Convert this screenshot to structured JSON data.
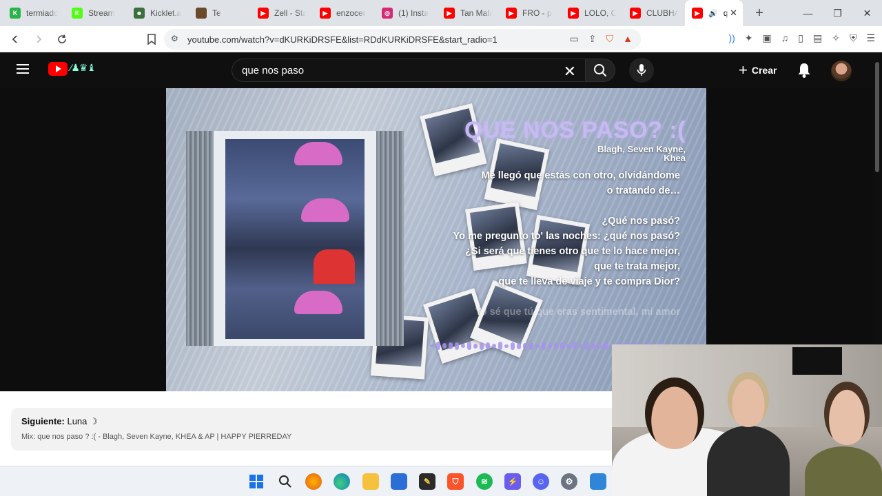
{
  "browser": {
    "tabs": [
      {
        "title": "termiado",
        "fav_color": "#2bb24c",
        "fav_glyph": "K"
      },
      {
        "title": "Stream",
        "fav_color": "#53fc18",
        "fav_glyph": "K"
      },
      {
        "title": "Kicklet.a",
        "fav_color": "#3d6e3d",
        "fav_glyph": "☻"
      },
      {
        "title": "Te",
        "fav_color": "#6b4a2b",
        "fav_glyph": ""
      },
      {
        "title": "Zell - Sta",
        "fav_color": "#ff0000",
        "fav_glyph": "▶"
      },
      {
        "title": "enzocer",
        "fav_color": "#ff0000",
        "fav_glyph": "▶"
      },
      {
        "title": "(1) Insta",
        "fav_color": "#d62976",
        "fav_glyph": "◎"
      },
      {
        "title": "Tan Mala",
        "fav_color": "#ff0000",
        "fav_glyph": "▶"
      },
      {
        "title": "FRO - p",
        "fav_color": "#ff0000",
        "fav_glyph": "▶"
      },
      {
        "title": "LOLO, Cl",
        "fav_color": "#ff0000",
        "fav_glyph": "▶"
      },
      {
        "title": "CLUBHA",
        "fav_color": "#ff0000",
        "fav_glyph": "▶"
      }
    ],
    "active_tab": {
      "title": "q",
      "fav_color": "#ff0000",
      "fav_glyph": "▶"
    },
    "url": "youtube.com/watch?v=dKURKiDRSFE&list=RDdKURKiDRSFE&start_radio=1"
  },
  "youtube": {
    "search_value": "que nos paso",
    "create_label": "Crear"
  },
  "video": {
    "song_title": "QUE NOS PASO? :(",
    "artist": "Blagh, Seven Kayne, Khea",
    "lyrics": [
      "Me llegó que estás con otro, olvidándome",
      "o tratando de…",
      "",
      "¿Qué nos pasó?",
      "Yo me pregunto to' las noches: ¿qué nos pasó?",
      "¿Si será que tienes otro que te lo hace mejor,",
      "que te trata mejor,",
      "que te lleva de viaje y te compra Dior?",
      "",
      "Yo sé que tú que eras sentimental, mi amor"
    ],
    "accent_color": "#c7b9f2"
  },
  "up_next": {
    "label": "Siguiente:",
    "title": "Luna ☽",
    "playlist": "Mix: que nos paso ? :( - Blagh, Seven Kayne, KHEA & AP | HAPPY PIERREDAY"
  },
  "taskbar": {
    "icons": [
      "windows-start",
      "search",
      "firefox",
      "edge",
      "file-explorer",
      "microsoft-store",
      "sticky-notes",
      "brave",
      "spotify",
      "pc-manager",
      "discord",
      "settings",
      "photos"
    ]
  }
}
